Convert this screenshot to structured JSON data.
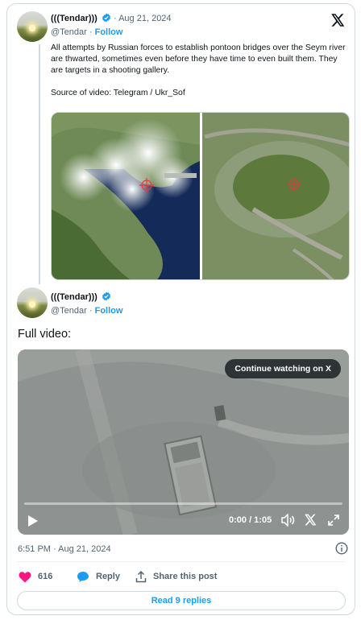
{
  "tweet1": {
    "author_name": "(((Tendar)))",
    "handle": "@Tendar",
    "separator": "·",
    "date": "Aug 21, 2024",
    "follow_label": "Follow",
    "text": "All attempts by Russian forces to establish pontoon bridges over the Seym river are thwarted, sometimes even before they have time to even built them.  They are targets in a shooting gallery.\n\nSource of video: Telegram / Ukr_Sof"
  },
  "tweet2": {
    "author_name": "(((Tendar)))",
    "handle": "@Tendar",
    "separator": "·",
    "follow_label": "Follow",
    "text": "Full video:",
    "video": {
      "continue_label": "Continue watching on X",
      "time": "0:00 / 1:05",
      "progress": 0
    },
    "timestamp": "6:51 PM · Aug 21, 2024",
    "likes_count": "616",
    "reply_label": "Reply",
    "share_label": "Share this post",
    "read_replies_label": "Read 9 replies"
  },
  "colors": {
    "accent": "#1d9bf0",
    "like": "#f91880",
    "muted": "#536471",
    "border": "#cfd9de"
  },
  "icons": [
    "verified-badge-icon",
    "x-logo-icon",
    "play-icon",
    "volume-icon",
    "fullscreen-icon",
    "info-icon",
    "heart-icon",
    "reply-bubble-icon",
    "share-icon",
    "target-reticle-icon"
  ]
}
